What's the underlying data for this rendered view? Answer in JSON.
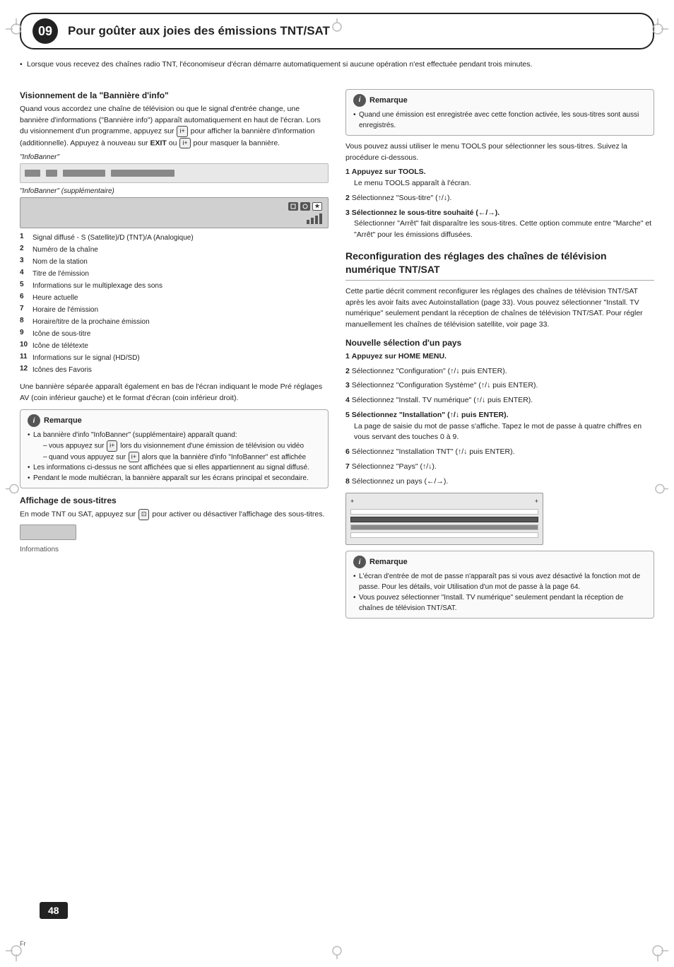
{
  "page": {
    "chapter_number": "09",
    "chapter_title": "Pour goûter aux joies des émissions TNT/SAT",
    "page_number": "48",
    "page_lang": "Fr"
  },
  "top_note": {
    "text": "Lorsque vous recevez des chaînes radio TNT, l'économiseur d'écran démarre automatiquement si aucune opération n'est effectuée pendant trois minutes."
  },
  "left_column": {
    "banniere_section": {
      "heading": "Visionnement de la \"Bannière d'info\"",
      "intro": "Quand vous accordez une chaîne de télévision ou que le signal d'entrée change, une bannière d'informations (\"Bannière info\") apparaît automatiquement en haut de l'écran. Lors du visionnement d'un programme, appuyez sur  pour afficher la bannière d'information (additionnelle). Appuyez à nouveau sur EXIT ou  pour masquer la bannière.",
      "banner1_label": "\"InfoBanner\"",
      "banner2_label": "\"InfoBanner\" (supplémentaire)",
      "signal_items": [
        {
          "num": "1",
          "text": "Signal diffusé - S (Satellite)/D (TNT)/A (Analogique)"
        },
        {
          "num": "2",
          "text": "Numéro de la chaîne"
        },
        {
          "num": "3",
          "text": "Nom de la station"
        },
        {
          "num": "4",
          "text": "Titre de l'émission"
        },
        {
          "num": "5",
          "text": "Informations sur le multiplexage des sons"
        },
        {
          "num": "6",
          "text": "Heure actuelle"
        },
        {
          "num": "7",
          "text": "Horaire de l'émission"
        },
        {
          "num": "8",
          "text": "Horaire/titre de la prochaine émission"
        },
        {
          "num": "9",
          "text": "Icône de sous-titre"
        },
        {
          "num": "10",
          "text": "Icône de télétexte"
        },
        {
          "num": "11",
          "text": "Informations sur le signal (HD/SD)"
        },
        {
          "num": "12",
          "text": "Icônes des Favoris"
        }
      ],
      "banner_desc": "Une bannière séparée apparaît également en bas de l'écran indiquant le mode Pré réglages AV (coin inférieur gauche) et le format d'écran (coin inférieur droit).",
      "remark": {
        "title": "Remarque",
        "items": [
          {
            "text": "La bannière d'info \"InfoBanner\" (supplémentaire) apparaît quand:",
            "subitems": [
              "vous appuyez sur  lors du visionnement d'une émission de télévision ou vidéo",
              "quand vous appuyez sur  alors que la bannière d'info \"InfoBanner\" est affichée"
            ]
          },
          {
            "text": "Les informations ci-dessus ne sont affichées que si elles appartiennent au signal diffusé."
          },
          {
            "text": "Pendant le mode multiécran, la bannière apparaît sur les écrans principal et secondaire."
          }
        ]
      }
    },
    "sous_titres_section": {
      "heading": "Affichage de sous-titres",
      "text": "En mode TNT ou SAT, appuyez sur  pour activer ou désactiver l'affichage des sous-titres."
    }
  },
  "right_column": {
    "remark": {
      "title": "Remarque",
      "items": [
        "Quand une émission est enregistrée avec cette fonction activée, les sous-titres sont aussi enregistrés."
      ]
    },
    "tools_intro": "Vous pouvez aussi utiliser le menu TOOLS pour sélectionner les sous-titres. Suivez la procédure ci-dessous.",
    "steps_tools": [
      {
        "num": "1",
        "text": "Appuyez sur TOOLS.",
        "detail": "Le menu TOOLS apparaît à l'écran."
      },
      {
        "num": "2",
        "text": "Sélectionnez \"Sous-titre\" (↑/↓)."
      },
      {
        "num": "3",
        "text": "Sélectionnez le sous-titre souhaité (←/→).",
        "detail": "Sélectionner \"Arrêt\" fait disparaître les sous-titres. Cette option commute entre \"Marche\" et \"Arrêt\" pour les émissions diffusées."
      }
    ],
    "reconfig_section": {
      "heading": "Reconfiguration des réglages des chaînes de télévision numérique TNT/SAT",
      "intro": "Cette partie décrit comment reconfigurer les réglages des chaînes de télévision TNT/SAT après les avoir faits avec Autoinstallation (page 33). Vous pouvez sélectionner \"Install. TV numérique\" seulement pendant la réception de chaînes de télévision TNT/SAT. Pour régler manuellement les chaînes de télévision satellite, voir page 33.",
      "nouvelle_section": {
        "heading": "Nouvelle sélection d'un pays",
        "steps": [
          {
            "num": "1",
            "text": "Appuyez sur HOME MENU."
          },
          {
            "num": "2",
            "text": "Sélectionnez \"Configuration\" (↑/↓ puis ENTER)."
          },
          {
            "num": "3",
            "text": "Sélectionnez \"Configuration Système\" (↑/↓ puis ENTER)."
          },
          {
            "num": "4",
            "text": "Sélectionnez \"Install. TV numérique\" (↑/↓ puis ENTER)."
          },
          {
            "num": "5",
            "text": "Sélectionnez \"Installation\" (↑/↓ puis ENTER).",
            "detail": "La page de saisie du mot de passe s'affiche. Tapez le mot de passe à quatre chiffres en vous servant des touches 0 à 9."
          },
          {
            "num": "6",
            "text": "Sélectionnez \"Installation TNT\" (↑/↓ puis ENTER)."
          },
          {
            "num": "7",
            "text": "Sélectionnez \"Pays\" (↑/↓)."
          },
          {
            "num": "8",
            "text": "Sélectionnez un pays (←/→)."
          }
        ]
      },
      "remark": {
        "title": "Remarque",
        "items": [
          "L'écran d'entrée de mot de passe n'apparaît pas si vous avez désactivé la fonction mot de passe. Pour les détails, voir Utilisation d'un mot de passe à la page 64.",
          "Vous pouvez sélectionner \"Install. TV numérique\" seulement pendant la réception de chaînes de télévision TNT/SAT."
        ]
      }
    }
  }
}
